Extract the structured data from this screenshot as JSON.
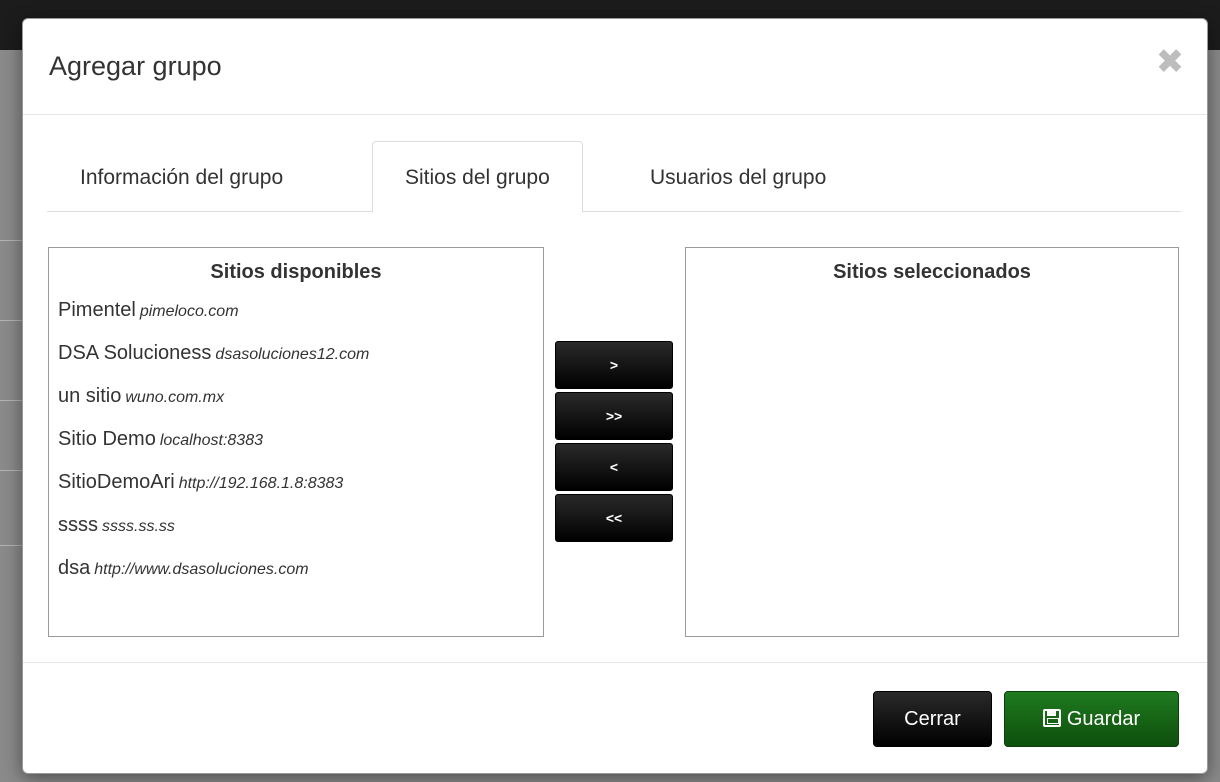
{
  "modal": {
    "title": "Agregar grupo",
    "close_glyph": "✖"
  },
  "tabs": [
    {
      "label": "Información del grupo",
      "active": false
    },
    {
      "label": "Sitios del grupo",
      "active": true
    },
    {
      "label": "Usuarios del grupo",
      "active": false
    }
  ],
  "available": {
    "title": "Sitios disponibles",
    "items": [
      {
        "name": "Pimentel",
        "url": "pimeloco.com"
      },
      {
        "name": "DSA Solucioness",
        "url": "dsasoluciones12.com"
      },
      {
        "name": "un sitio",
        "url": "wuno.com.mx"
      },
      {
        "name": "Sitio Demo",
        "url": "localhost:8383"
      },
      {
        "name": "SitioDemoAri",
        "url": "http://192.168.1.8:8383"
      },
      {
        "name": "ssss",
        "url": "ssss.ss.ss"
      },
      {
        "name": "dsa",
        "url": "http://www.dsasoluciones.com"
      }
    ]
  },
  "selected": {
    "title": "Sitios seleccionados",
    "items": []
  },
  "move_buttons": {
    "add_one": ">",
    "add_all": ">>",
    "remove_one": "<",
    "remove_all": "<<"
  },
  "footer": {
    "close_label": "Cerrar",
    "save_label": "Guardar",
    "save_icon": "floppy-disk-icon",
    "save_color": "#1a6e1a"
  }
}
